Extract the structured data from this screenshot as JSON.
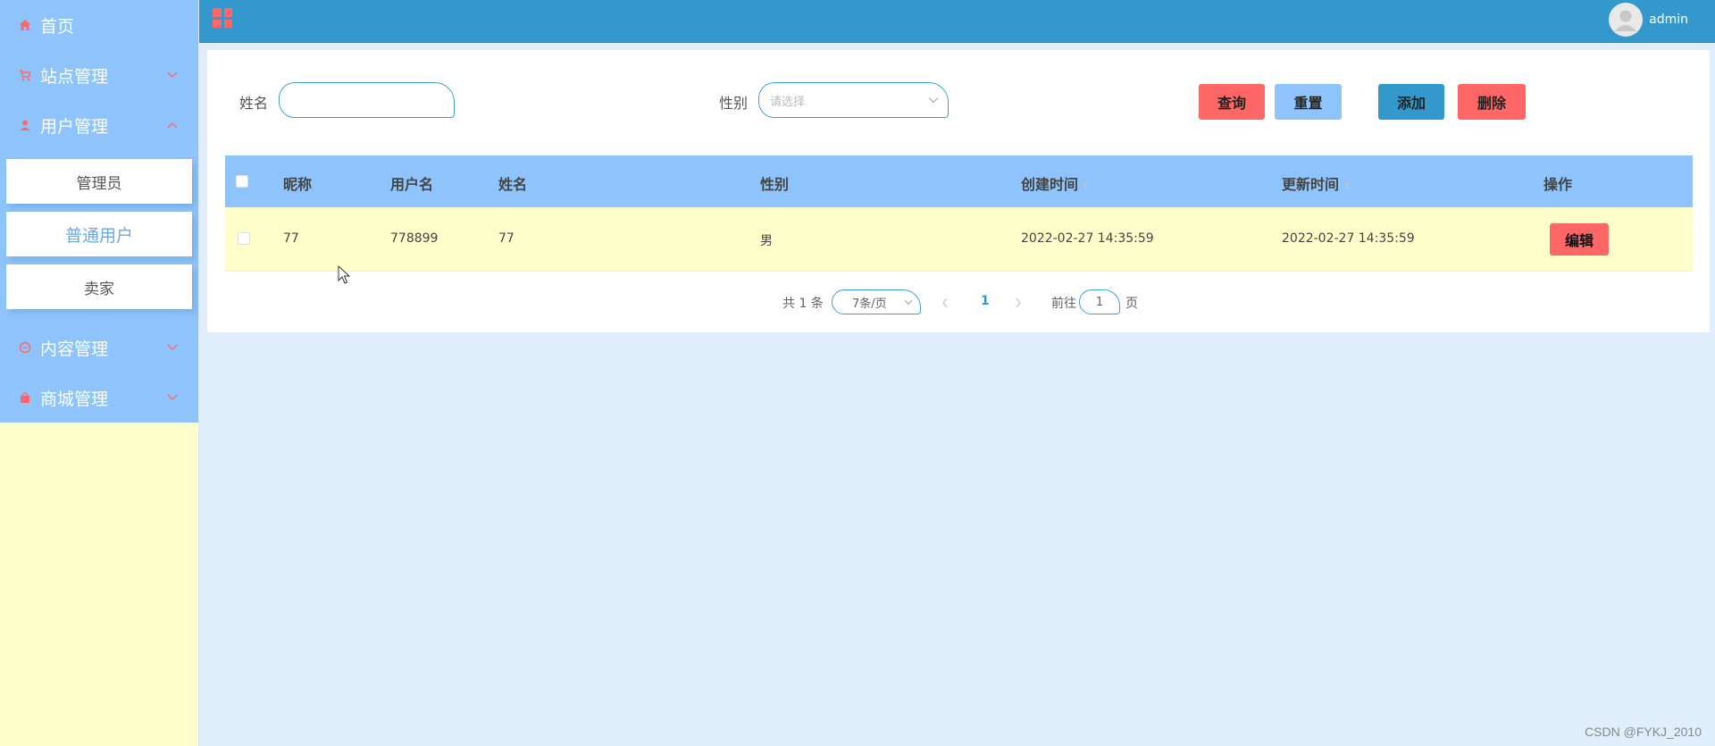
{
  "sidebar": {
    "home": "首页",
    "site_manage": "站点管理",
    "user_manage": "用户管理",
    "user_sub": [
      "管理员",
      "普通用户",
      "卖家"
    ],
    "content_manage": "内容管理",
    "mall_manage": "商城管理"
  },
  "header": {
    "user": "admin"
  },
  "search": {
    "name_label": "姓名",
    "name_value": "",
    "gender_label": "性别",
    "gender_placeholder": "请选择"
  },
  "buttons": {
    "query": "查询",
    "reset": "重置",
    "add": "添加",
    "delete": "删除"
  },
  "table": {
    "columns": [
      "昵称",
      "用户名",
      "姓名",
      "性别",
      "创建时间",
      "更新时间",
      "操作"
    ],
    "rows": [
      {
        "nickname": "77",
        "username": "778899",
        "name": "77",
        "gender": "男",
        "created": "2022-02-27 14:35:59",
        "updated": "2022-02-27 14:35:59",
        "action": "编辑"
      }
    ]
  },
  "pagination": {
    "total": "共 1 条",
    "page_size": "7条/页",
    "current": "1",
    "goto_prefix": "前往",
    "goto_value": "1",
    "goto_suffix": "页"
  },
  "watermark": "CSDN @FYKJ_2010",
  "colors": {
    "sidebar_menu": "#8ec4fb",
    "sidebar_bg": "#ffffcc",
    "header": "#3399cc",
    "accent_red": "#ff6666",
    "page_bg": "#e1effc"
  }
}
